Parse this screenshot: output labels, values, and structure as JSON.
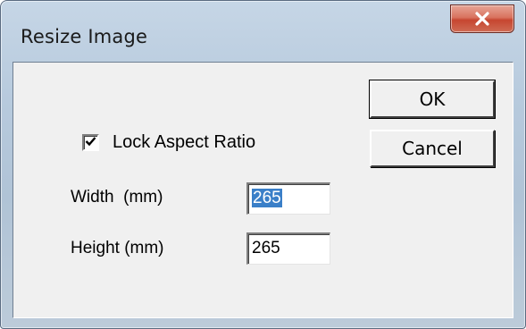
{
  "window": {
    "title": "Resize Image"
  },
  "icons": {
    "close": "close-icon",
    "check": "checkmark-icon"
  },
  "buttons": {
    "ok_label": "OK",
    "cancel_label": "Cancel"
  },
  "lock_aspect": {
    "label": "Lock Aspect Ratio",
    "checked": true
  },
  "width": {
    "label": "Width  (mm)",
    "value": "265",
    "selected": true
  },
  "height": {
    "label": "Height (mm)",
    "value": "265"
  },
  "colors": {
    "selection": "#3a7fc8",
    "close_button": "#c64630"
  }
}
